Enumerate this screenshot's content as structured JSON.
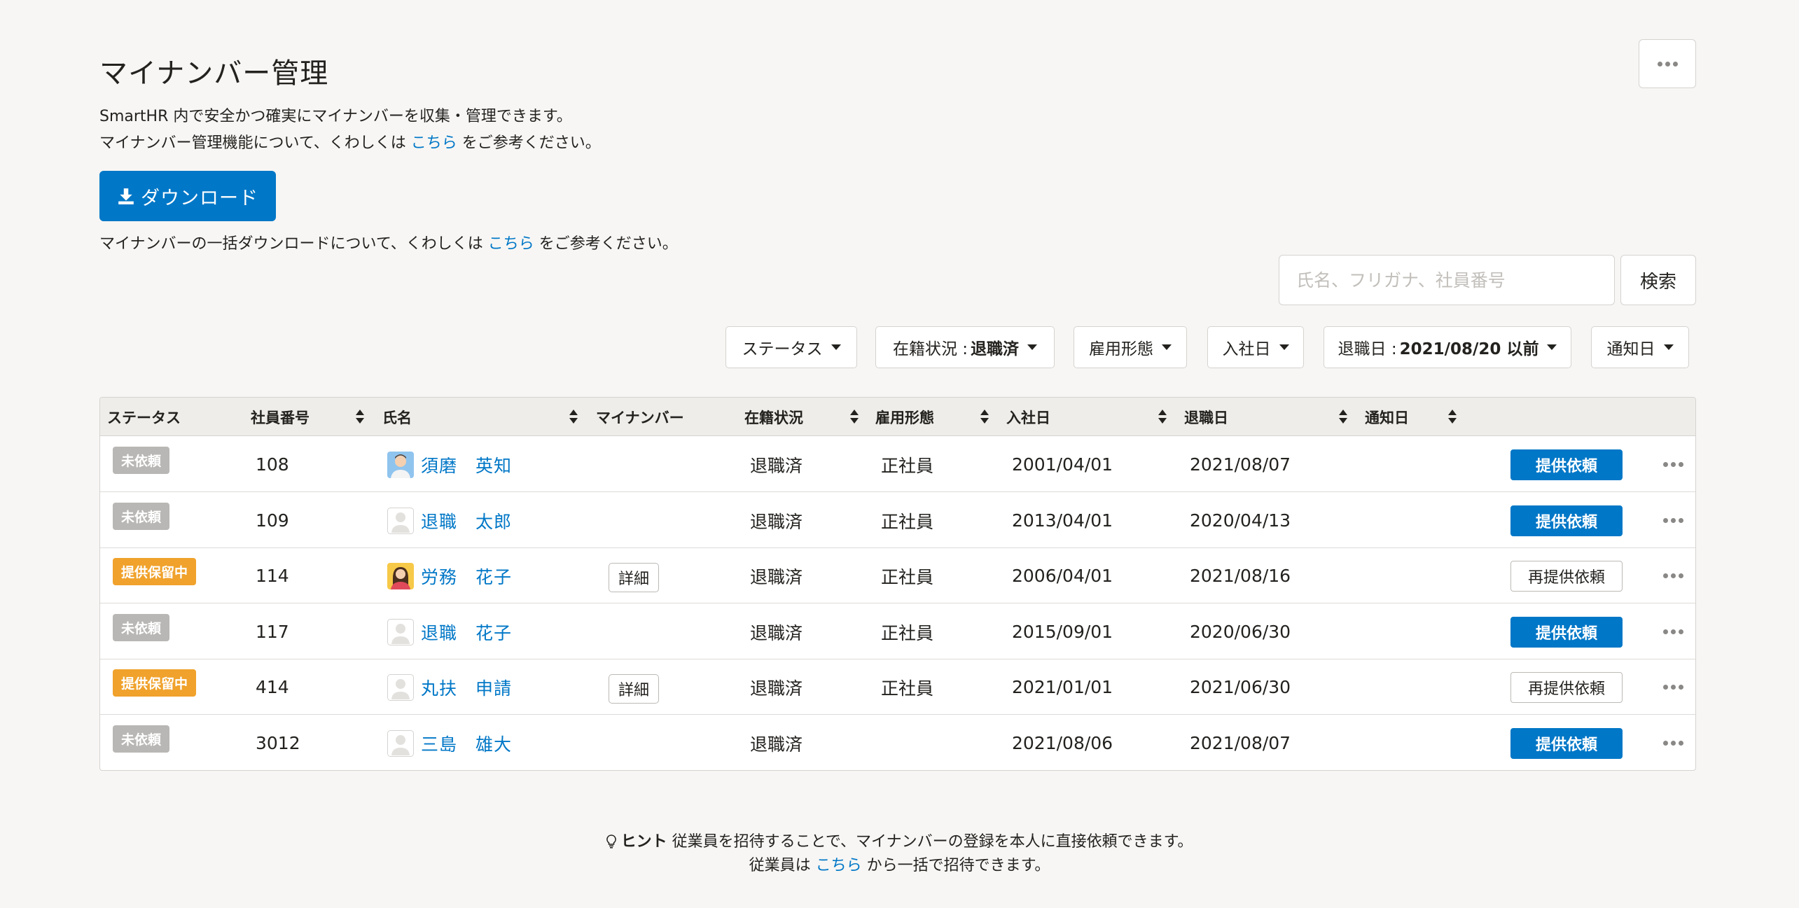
{
  "page": {
    "title": "マイナンバー管理",
    "desc_line1": "SmartHR 内で安全かつ確実にマイナンバーを収集・管理できます。",
    "desc_line2_pre": "マイナンバー管理機能について、くわしくは ",
    "desc_line2_link": "こちら",
    "desc_line2_post": " をご参考ください。"
  },
  "download": {
    "label": "ダウンロード",
    "desc_pre": "マイナンバーの一括ダウンロードについて、くわしくは ",
    "desc_link": "こちら",
    "desc_post": " をご参考ください。"
  },
  "search": {
    "placeholder": "氏名、フリガナ、社員番号",
    "button": "検索"
  },
  "filters": {
    "status": "ステータス",
    "enrollment_label": "在籍状況 : ",
    "enrollment_value": "退職済",
    "employment_type": "雇用形態",
    "join_date": "入社日",
    "leave_label": "退職日 : ",
    "leave_value": "2021/08/20 以前",
    "notify_date": "通知日"
  },
  "table": {
    "headers": {
      "status": "ステータス",
      "employee_no": "社員番号",
      "name": "氏名",
      "mynumber": "マイナンバー",
      "enrollment": "在籍状況",
      "employment_type": "雇用形態",
      "join_date": "入社日",
      "leave_date": "退職日",
      "notify_date": "通知日"
    },
    "detail_label": "詳細",
    "rows": [
      {
        "status": "未依頼",
        "no": "108",
        "name": "須磨　英知",
        "enrollment": "退職済",
        "type": "正社員",
        "join": "2001/04/01",
        "leave": "2021/08/07",
        "action": "提供依頼"
      },
      {
        "status": "未依頼",
        "no": "109",
        "name": "退職　太郎",
        "enrollment": "退職済",
        "type": "正社員",
        "join": "2013/04/01",
        "leave": "2020/04/13",
        "action": "提供依頼"
      },
      {
        "status": "提供保留中",
        "no": "114",
        "name": "労務　花子",
        "enrollment": "退職済",
        "type": "正社員",
        "join": "2006/04/01",
        "leave": "2021/08/16",
        "action": "再提供依頼"
      },
      {
        "status": "未依頼",
        "no": "117",
        "name": "退職　花子",
        "enrollment": "退職済",
        "type": "正社員",
        "join": "2015/09/01",
        "leave": "2020/06/30",
        "action": "提供依頼"
      },
      {
        "status": "提供保留中",
        "no": "414",
        "name": "丸扶　申請",
        "enrollment": "退職済",
        "type": "正社員",
        "join": "2021/01/01",
        "leave": "2021/06/30",
        "action": "再提供依頼"
      },
      {
        "status": "未依頼",
        "no": "3012",
        "name": "三島　雄大",
        "enrollment": "退職済",
        "type": "",
        "join": "2021/08/06",
        "leave": "2021/08/07",
        "action": "提供依頼"
      }
    ]
  },
  "hint": {
    "label": "ヒント",
    "line1": " 従業員を招待することで、マイナンバーの登録を本人に直接依頼できます。",
    "line2_pre": "従業員は ",
    "line2_link": "こちら",
    "line2_post": " から一括で招待できます。"
  },
  "colors": {
    "accent": "#0077c7",
    "badge_gray": "#b9b7b5",
    "badge_orange": "#f0a22c",
    "background": "#f7f6f4"
  },
  "icons": {
    "download": "download-icon",
    "more": "more-horizontal-icon",
    "sort": "sort-icon",
    "hint": "lightbulb-icon",
    "avatar": "avatar-icon"
  }
}
